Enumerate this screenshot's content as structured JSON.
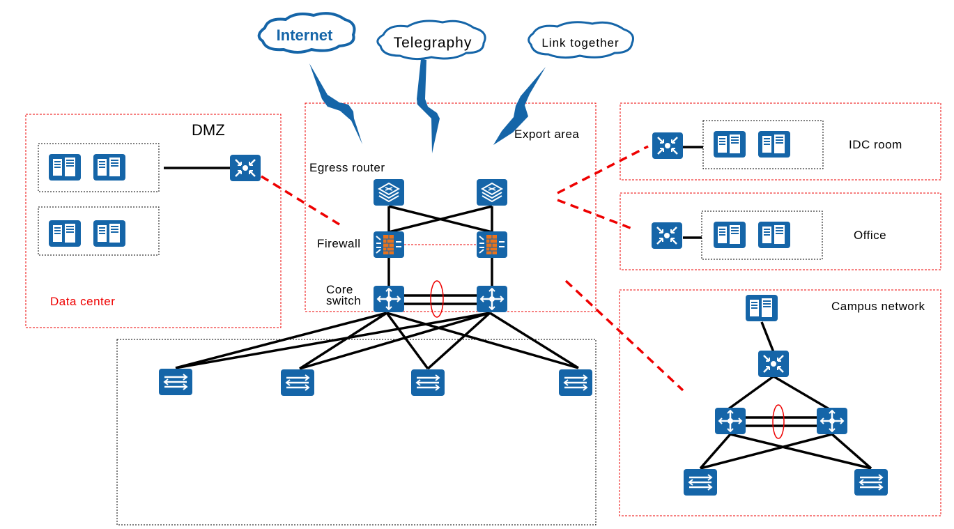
{
  "colors": {
    "icon": "#1565a8",
    "zone_border": "#ee0000",
    "firewall_brick": "#e8731e"
  },
  "clouds": [
    {
      "label": "Internet"
    },
    {
      "label": "Telegraphy"
    },
    {
      "label": "Link together"
    }
  ],
  "zones": {
    "dmz": {
      "title": "DMZ",
      "subtitle": "Data center"
    },
    "export": {
      "title": "Export area",
      "egress_router": "Egress router",
      "firewall": "Firewall",
      "core_switch_line1": "Core",
      "core_switch_line2": "switch"
    },
    "idc": {
      "title": "IDC room"
    },
    "office": {
      "title": "Office"
    },
    "campus": {
      "title": "Campus network"
    }
  }
}
